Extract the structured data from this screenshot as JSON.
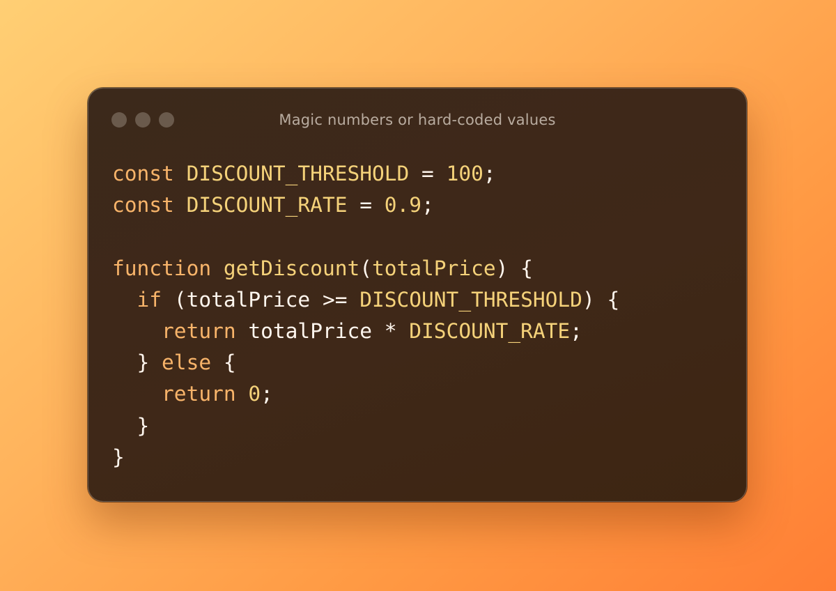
{
  "window": {
    "title": "Magic numbers or hard-coded values",
    "controls": [
      "close",
      "minimize",
      "zoom"
    ]
  },
  "code": {
    "language": "javascript",
    "lines": [
      [
        {
          "t": "const",
          "k": "keyword"
        },
        {
          "t": " ",
          "k": "plain"
        },
        {
          "t": "DISCOUNT_THRESHOLD",
          "k": "constant"
        },
        {
          "t": " = ",
          "k": "plain"
        },
        {
          "t": "100",
          "k": "number"
        },
        {
          "t": ";",
          "k": "plain"
        }
      ],
      [
        {
          "t": "const",
          "k": "keyword"
        },
        {
          "t": " ",
          "k": "plain"
        },
        {
          "t": "DISCOUNT_RATE",
          "k": "constant"
        },
        {
          "t": " = ",
          "k": "plain"
        },
        {
          "t": "0.9",
          "k": "number"
        },
        {
          "t": ";",
          "k": "plain"
        }
      ],
      [],
      [
        {
          "t": "function",
          "k": "keyword"
        },
        {
          "t": " ",
          "k": "plain"
        },
        {
          "t": "getDiscount",
          "k": "function"
        },
        {
          "t": "(",
          "k": "plain"
        },
        {
          "t": "totalPrice",
          "k": "function"
        },
        {
          "t": ") {",
          "k": "plain"
        }
      ],
      [
        {
          "t": "  ",
          "k": "plain"
        },
        {
          "t": "if",
          "k": "keyword"
        },
        {
          "t": " (totalPrice >= ",
          "k": "plain"
        },
        {
          "t": "DISCOUNT_THRESHOLD",
          "k": "constant"
        },
        {
          "t": ") {",
          "k": "plain"
        }
      ],
      [
        {
          "t": "    ",
          "k": "plain"
        },
        {
          "t": "return",
          "k": "keyword"
        },
        {
          "t": " totalPrice * ",
          "k": "plain"
        },
        {
          "t": "DISCOUNT_RATE",
          "k": "constant"
        },
        {
          "t": ";",
          "k": "plain"
        }
      ],
      [
        {
          "t": "  } ",
          "k": "plain"
        },
        {
          "t": "else",
          "k": "keyword"
        },
        {
          "t": " {",
          "k": "plain"
        }
      ],
      [
        {
          "t": "    ",
          "k": "plain"
        },
        {
          "t": "return",
          "k": "keyword"
        },
        {
          "t": " ",
          "k": "plain"
        },
        {
          "t": "0",
          "k": "number"
        },
        {
          "t": ";",
          "k": "plain"
        }
      ],
      [
        {
          "t": "  }",
          "k": "plain"
        }
      ],
      [
        {
          "t": "}",
          "k": "plain"
        }
      ]
    ]
  },
  "colors": {
    "background_start": "#ffcf74",
    "background_end": "#ff7e34",
    "window_bg": "#3e2816",
    "keyword": "#f8b46a",
    "constant": "#f5d27a",
    "plain": "#fff6ee",
    "title": "#b9aca0",
    "window_dot": "#6a5a4c"
  }
}
